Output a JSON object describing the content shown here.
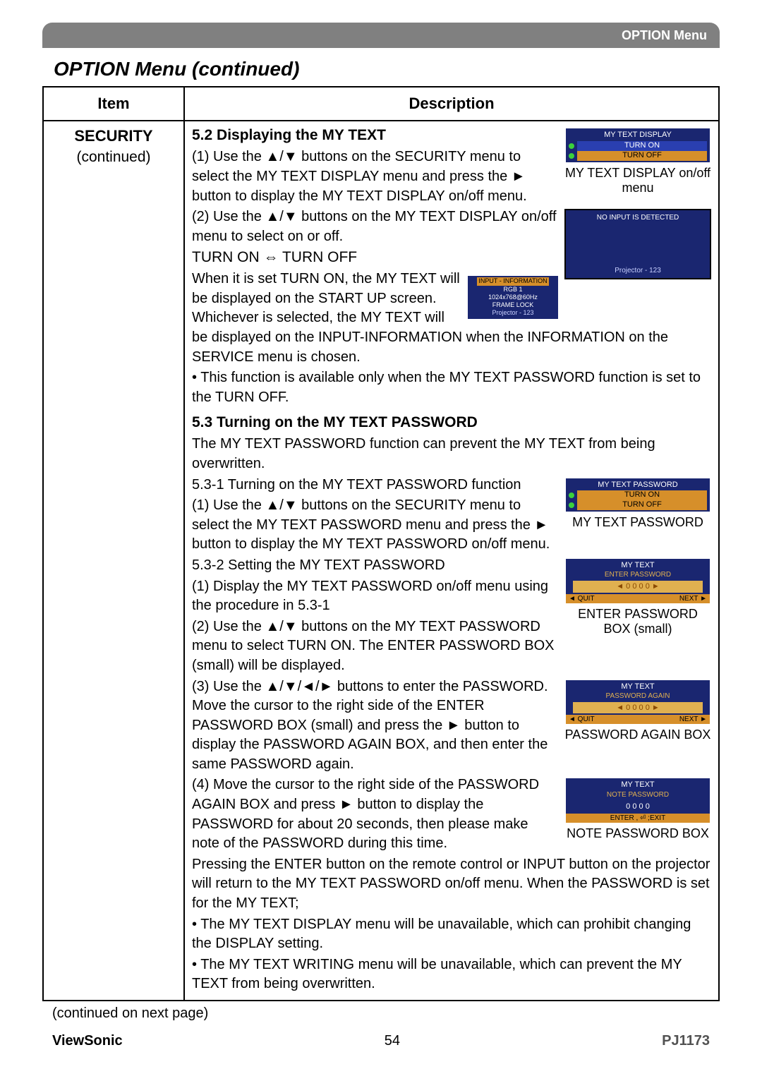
{
  "topbar": {
    "label": "OPTION Menu"
  },
  "heading": "OPTION Menu (continued)",
  "table": {
    "head_item": "Item",
    "head_desc": "Description",
    "item_name": "SECURITY",
    "item_sub": "(continued)"
  },
  "s52": {
    "title": "5.2 Displaying the MY TEXT",
    "step1": "(1) Use the ▲/▼ buttons on the SECURITY menu to select the MY TEXT DISPLAY menu and press the ► button to display the MY TEXT DISPLAY on/off menu.",
    "step2": "(2) Use the ▲/▼ buttons on the MY TEXT DISPLAY on/off menu to select on or off.",
    "toggle": "TURN ON ⇔ TURN OFF",
    "para1": "When it is set TURN ON, the MY TEXT will be displayed on the START UP screen. Whichever is selected, the MY TEXT will be displayed on the INPUT-INFORMATION when the INFORMATION on the SERVICE menu is chosen.",
    "bullet1": "• This function is available only when the MY TEXT PASSWORD function is set to the TURN OFF."
  },
  "osd1": {
    "title": "MY TEXT DISPLAY",
    "on": "TURN ON",
    "off": "TURN OFF",
    "caption": "MY TEXT DISPLAY on/off menu"
  },
  "osd2": {
    "line1": "NO INPUT IS DETECTED",
    "line2": "Projector - 123"
  },
  "osd3": {
    "hdr": "INPUT - INFORMATION",
    "l1": "RGB 1",
    "l2": "1024x768@60Hz",
    "l3": "FRAME LOCK",
    "l4": "Projector - 123"
  },
  "s53": {
    "title": "5.3 Turning on the MY TEXT PASSWORD",
    "lead": "The MY TEXT PASSWORD function can prevent the MY TEXT from being overwritten.",
    "sub1": "5.3-1 Turning on the MY TEXT PASSWORD function",
    "step1": "(1) Use the ▲/▼ buttons on the SECURITY menu to select the MY TEXT PASSWORD menu and press the ► button to display the MY TEXT PASSWORD on/off menu.",
    "sub2": "5.3-2 Setting the MY TEXT PASSWORD",
    "step21": "(1) Display the MY TEXT PASSWORD on/off menu using the procedure in 5.3-1",
    "step22": "(2) Use the ▲/▼ buttons on the MY TEXT PASSWORD menu to select TURN ON. The ENTER PASSWORD BOX (small) will be displayed.",
    "step23": "(3) Use the ▲/▼/◄/► buttons to enter the PASSWORD. Move the cursor to the right side of the ENTER PASSWORD BOX (small) and press the ► button to display the PASSWORD AGAIN BOX, and then enter the same PASSWORD again.",
    "step24": "(4) Move the cursor to the right side of the PASSWORD AGAIN BOX and press ► button to display the PASSWORD for about 20 seconds, then please make note of the PASSWORD during this time.",
    "para2": "Pressing the ENTER button on the remote control or INPUT button on the projector will return to the MY TEXT PASSWORD on/off menu. When the PASSWORD is set for the MY TEXT;",
    "bullet2": "• The MY TEXT DISPLAY menu will be unavailable, which can prohibit changing the DISPLAY setting.",
    "bullet3": "• The MY TEXT WRITING menu will be unavailable, which can prevent the MY TEXT from being overwritten."
  },
  "osd4": {
    "title": "MY TEXT PASSWORD",
    "on": "TURN ON",
    "off": "TURN OFF",
    "caption": "MY TEXT PASSWORD"
  },
  "osd5": {
    "title": "MY TEXT",
    "sub": "ENTER PASSWORD",
    "digits": "◄ 0 0 0 0 ►",
    "left": "◄ QUIT",
    "right": "NEXT ►",
    "caption": "ENTER PASSWORD BOX (small)"
  },
  "osd6": {
    "title": "MY TEXT",
    "sub": "PASSWORD AGAIN",
    "digits": "◄ 0 0 0 0 ►",
    "left": "◄ QUIT",
    "right": "NEXT ►",
    "caption": "PASSWORD AGAIN BOX"
  },
  "osd7": {
    "title": "MY TEXT",
    "sub": "NOTE PASSWORD",
    "digits": "0 0 0 0",
    "bot": "ENTER , ⏎ ;EXIT",
    "caption": "NOTE PASSWORD BOX"
  },
  "continued": "(continued on next page)",
  "footer": {
    "brand": "ViewSonic",
    "page": "54",
    "model": "PJ1173"
  }
}
